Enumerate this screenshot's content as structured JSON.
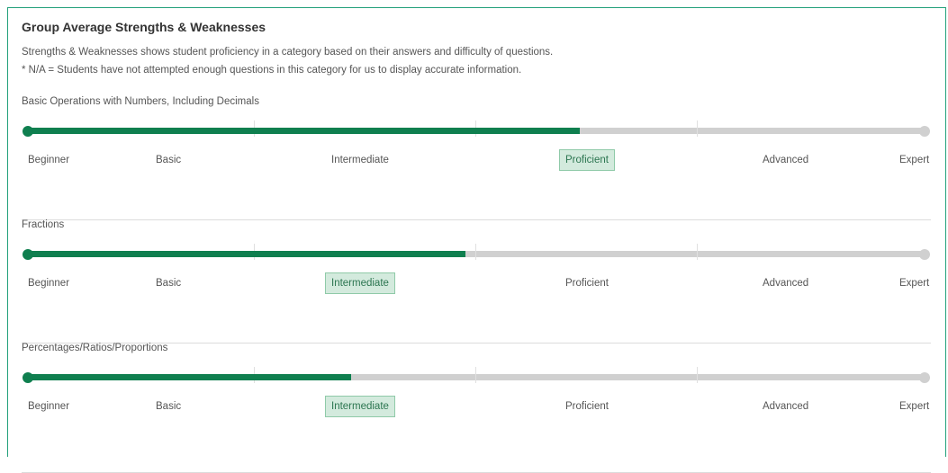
{
  "card": {
    "title": "Group Average Strengths & Weaknesses",
    "description_line1": "Strengths & Weaknesses shows student proficiency in a category based on their answers and difficulty of questions.",
    "description_line2": "* N/A = Students have not attempted enough questions in this category for us to display accurate information."
  },
  "levels": [
    "Beginner",
    "Basic",
    "Intermediate",
    "Proficient",
    "Advanced",
    "Expert"
  ],
  "categories": [
    {
      "name": "Basic Operations with Numbers, Including Decimals",
      "current_level": "Proficient",
      "progress_fraction": 0.615
    },
    {
      "name": "Fractions",
      "current_level": "Intermediate",
      "progress_fraction": 0.488
    },
    {
      "name": "Percentages/Ratios/Proportions",
      "current_level": "Intermediate",
      "progress_fraction": 0.36
    }
  ],
  "colors": {
    "accent": "#0f7f4f",
    "track": "#d0d0d0",
    "active_badge_bg": "#d3eadd",
    "border": "#22a07a"
  }
}
